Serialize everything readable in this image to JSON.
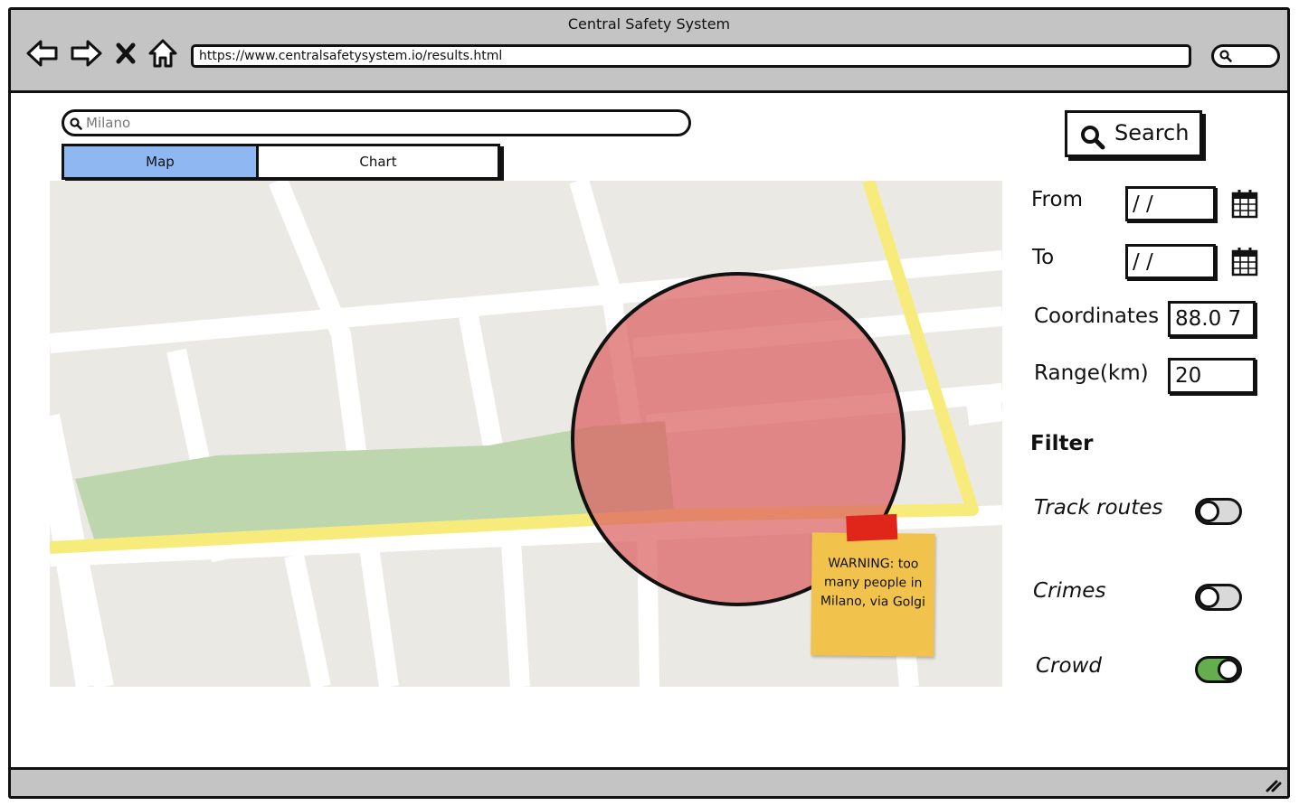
{
  "window": {
    "title": "Central Safety System"
  },
  "browser": {
    "url": "https://www.centralsafetysystem.io/results.html",
    "nav_icons": [
      "back-arrow-icon",
      "forward-arrow-icon",
      "stop-x-icon",
      "home-icon"
    ]
  },
  "search": {
    "value": "",
    "placeholder": "Milano"
  },
  "tabs": [
    {
      "label": "Map",
      "selected": true
    },
    {
      "label": "Chart",
      "selected": false
    }
  ],
  "map": {
    "warning_note": "WARNING: too many people in Milano, via Golgi"
  },
  "panel": {
    "search_button": "Search",
    "from_label": "From",
    "from_value": " /  /",
    "to_label": "To",
    "to_value": " /  /",
    "coordinates_label": "Coordinates",
    "coordinates_value": "88.0 7",
    "range_label": "Range(km)",
    "range_value": "20",
    "filter_title": "Filter",
    "filters": [
      {
        "label": "Track routes",
        "on": false
      },
      {
        "label": "Crimes",
        "on": false
      },
      {
        "label": "Crowd",
        "on": true
      }
    ]
  },
  "colors": {
    "tab_selected": "#8fb8f2",
    "toggle_on": "#64ae4d",
    "alert_circle": "#e0787a",
    "park": "#bed6ae",
    "main_road": "#f7ec7b",
    "sticky_note": "#f1c34c",
    "sticky_tape": "#e0251b",
    "chrome": "#c4c4c4"
  }
}
